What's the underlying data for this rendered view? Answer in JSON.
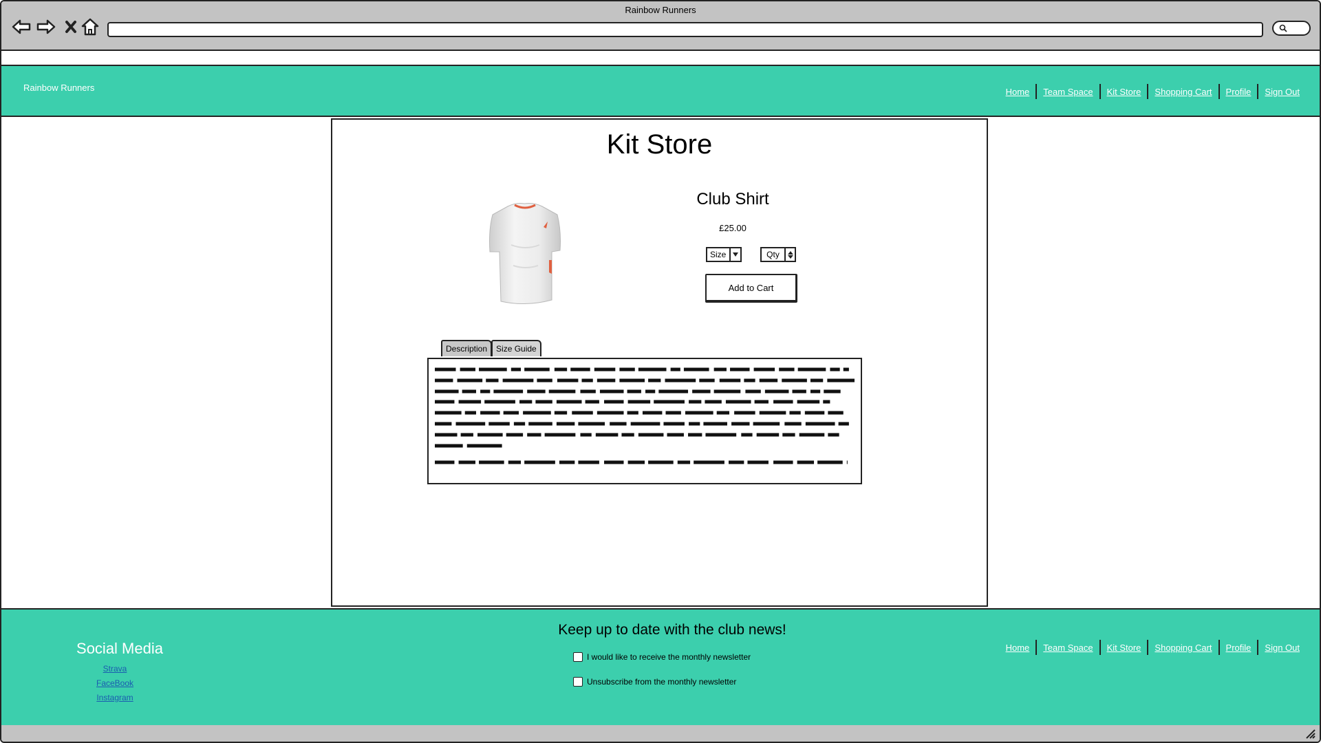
{
  "window": {
    "title": "Rainbow Runners"
  },
  "browser": {
    "back_icon": "arrow-left-icon",
    "forward_icon": "arrow-right-icon",
    "stop_icon": "close-icon",
    "home_icon": "home-icon",
    "search_icon": "search-icon",
    "address_value": ""
  },
  "header": {
    "brand": "Rainbow Runners",
    "nav": [
      "Home",
      "Team Space",
      "Kit Store",
      "Shopping Cart",
      "Profile",
      "Sign Out"
    ],
    "background": "#3ccfad"
  },
  "main": {
    "title": "Kit Store",
    "product": {
      "name": "Club Shirt",
      "price": "£25.00",
      "size_label": "Size",
      "qty_label": "Qty",
      "add_button": "Add to Cart",
      "image_icon": "t-shirt-image"
    },
    "tabs": [
      {
        "label": "Description",
        "active": true
      },
      {
        "label": "Size Guide",
        "active": false
      }
    ]
  },
  "footer": {
    "social_heading": "Social Media",
    "social_links": [
      "Strava",
      "FaceBook",
      "Instagram"
    ],
    "news_heading": "Keep up to date with the club news!",
    "newsletter_options": [
      {
        "label": "I would like to receive the monthly newsletter",
        "checked": false
      },
      {
        "label": "Unsubscribe from the monthly newsletter",
        "checked": false
      }
    ],
    "nav": [
      "Home",
      "Team Space",
      "Kit Store",
      "Shopping Cart",
      "Profile",
      "Sign Out"
    ]
  }
}
